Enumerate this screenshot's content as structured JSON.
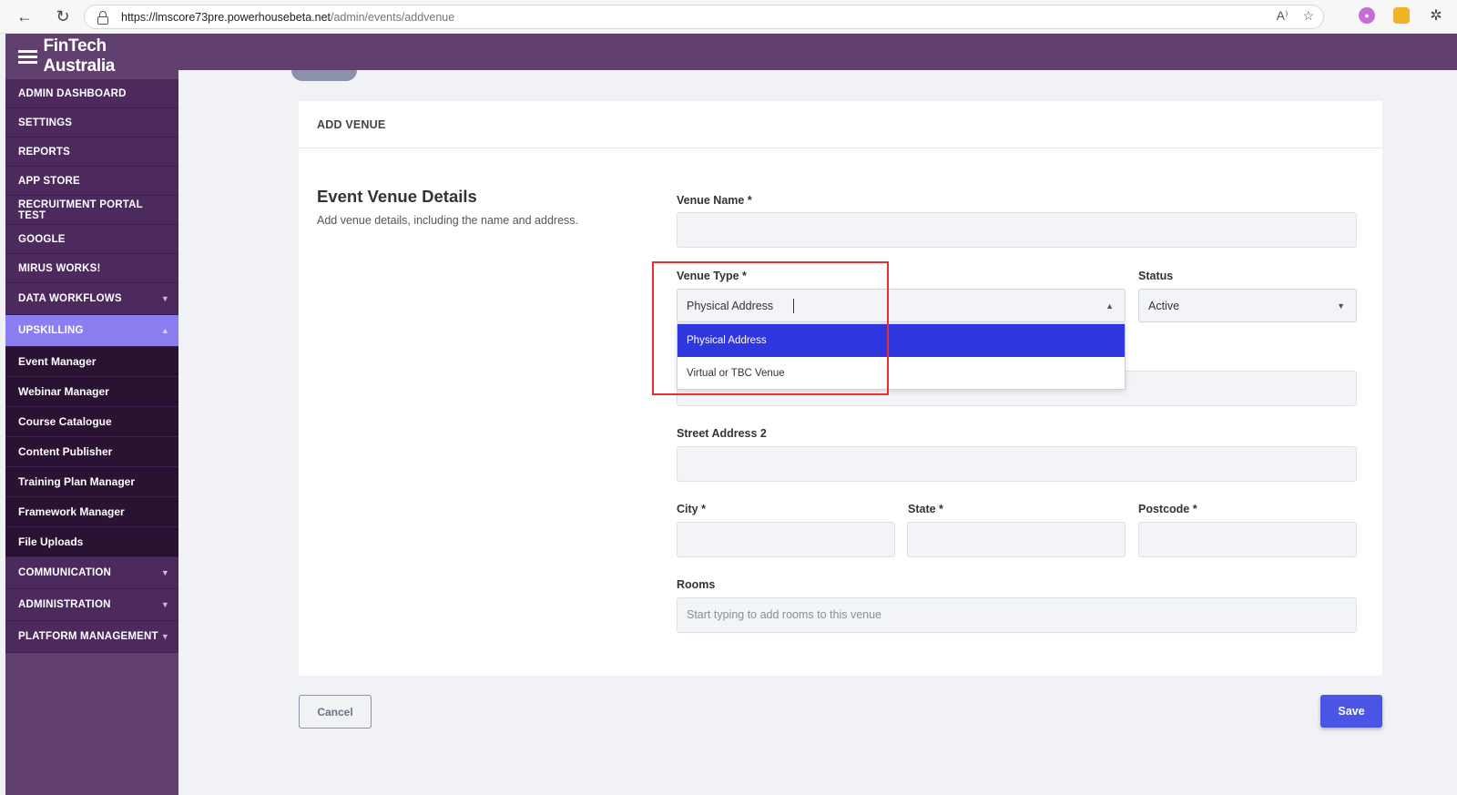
{
  "browser": {
    "url_domain": "https://lmscore73pre.powerhousebeta.net",
    "url_path": "/admin/events/addvenue",
    "back_icon": "←",
    "refresh_icon": "↻",
    "read_aloud_icon": "A⁾",
    "favorite_icon": "☆"
  },
  "brand": {
    "name": "FinTech Australia"
  },
  "sidebar": {
    "items": [
      {
        "label": "ADMIN DASHBOARD"
      },
      {
        "label": "SETTINGS"
      },
      {
        "label": "REPORTS"
      },
      {
        "label": "APP STORE"
      },
      {
        "label": "RECRUITMENT PORTAL TEST"
      },
      {
        "label": "GOOGLE"
      },
      {
        "label": "MIRUS WORKS!"
      },
      {
        "label": "DATA WORKFLOWS"
      },
      {
        "label": "UPSKILLING"
      }
    ],
    "submenu": [
      {
        "label": "Event Manager"
      },
      {
        "label": "Webinar Manager"
      },
      {
        "label": "Course Catalogue"
      },
      {
        "label": "Content Publisher"
      },
      {
        "label": "Training Plan Manager"
      },
      {
        "label": "Framework Manager"
      },
      {
        "label": "File Uploads"
      }
    ],
    "bottom_items": [
      {
        "label": "COMMUNICATION"
      },
      {
        "label": "ADMINISTRATION"
      },
      {
        "label": "PLATFORM MANAGEMENT"
      }
    ],
    "active_color": "#8c7df0",
    "bg_color": "#614070"
  },
  "card": {
    "header": "ADD VENUE",
    "section_title": "Event Venue Details",
    "section_desc": "Add venue details, including the name and address."
  },
  "form": {
    "venue_name_label": "Venue Name *",
    "venue_name_value": "",
    "venue_type_label": "Venue Type *",
    "venue_type_value": "Physical Address",
    "venue_type_options": [
      "Physical Address",
      "Virtual or TBC Venue"
    ],
    "status_label": "Status",
    "status_value": "Active",
    "street_address_1_value": "",
    "street_address_2_label": "Street Address 2",
    "street_address_2_value": "",
    "city_label": "City *",
    "state_label": "State *",
    "postcode_label": "Postcode *",
    "rooms_label": "Rooms",
    "rooms_placeholder": "Start typing to add rooms to this venue"
  },
  "actions": {
    "cancel_label": "Cancel",
    "save_label": "Save",
    "save_color": "#4a55e6"
  }
}
